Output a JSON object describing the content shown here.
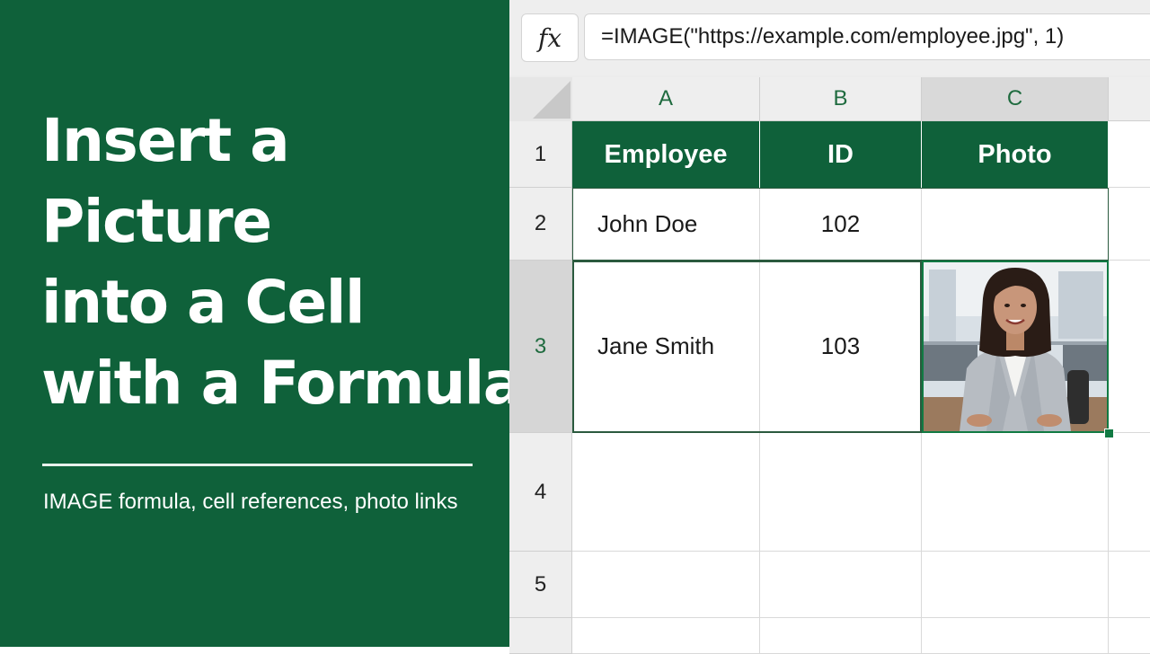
{
  "hero": {
    "title_lines": [
      "Insert a",
      "Picture",
      "into a Cell",
      "with a Formula"
    ],
    "subtitle": "IMAGE formula, cell references, photo links"
  },
  "formula_bar": {
    "fx_label": "fx",
    "formula": "=IMAGE(\"https://example.com/employee.jpg\", 1)"
  },
  "sheet": {
    "columns": [
      "A",
      "B",
      "C"
    ],
    "rows": [
      "1",
      "2",
      "3",
      "4",
      "5"
    ],
    "header": {
      "a": "Employee",
      "b": "ID",
      "c": "Photo"
    },
    "data": [
      {
        "name": "John Doe",
        "id": "102"
      },
      {
        "name": "Jane Smith",
        "id": "103"
      }
    ],
    "selected_column": "C",
    "selected_row": "3"
  },
  "colors": {
    "brand_green": "#0f613a",
    "accent_green": "#117a43"
  }
}
